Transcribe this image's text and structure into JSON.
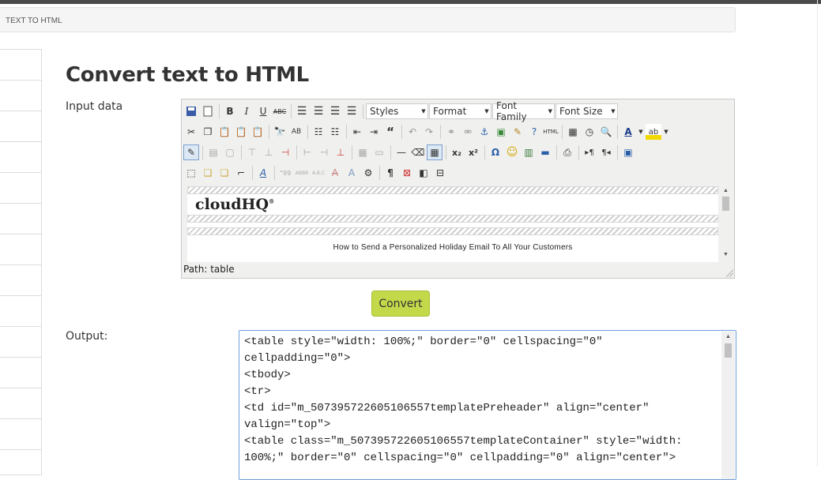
{
  "breadcrumb": "TEXT TO HTML",
  "page_title": "Convert text to HTML",
  "input_label": "Input data",
  "output_label": "Output:",
  "toolbar": {
    "styles": "Styles",
    "format": "Format",
    "font_family": "Font Family",
    "font_size": "Font Size"
  },
  "editor": {
    "logo": "cloudHQ",
    "email_line": "How to Send a Personalized Holiday Email To All Your Customers",
    "path": "Path: table"
  },
  "convert_label": "Convert",
  "output_text": "<table style=\"width: 100%;\" border=\"0\" cellspacing=\"0\"\ncellpadding=\"0\">\n<tbody>\n<tr>\n<td id=\"m_507395722605106557templatePreheader\" align=\"center\"\nvalign=\"top\">\n<table class=\"m_507395722605106557templateContainer\" style=\"width:\n100%;\" border=\"0\" cellspacing=\"0\" cellpadding=\"0\" align=\"center\">"
}
